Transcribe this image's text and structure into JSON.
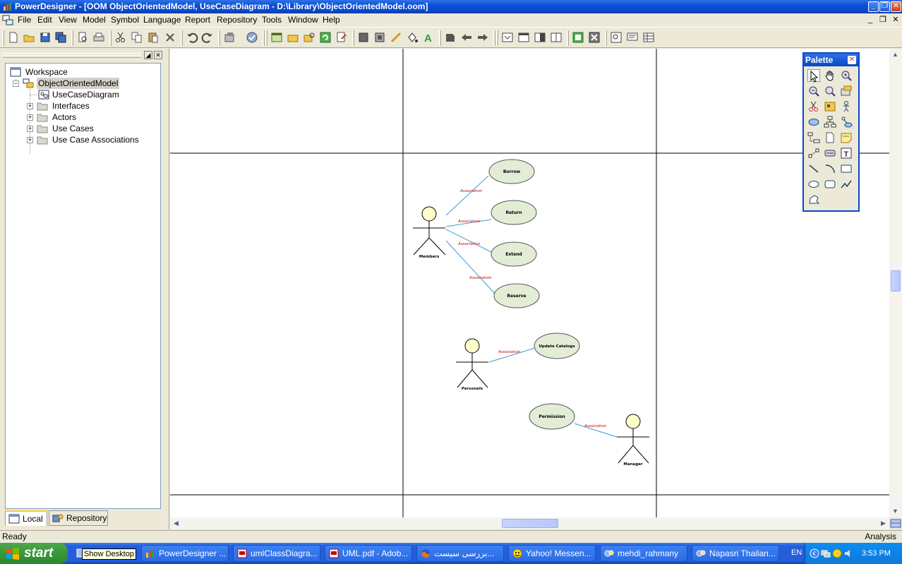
{
  "window": {
    "title": "PowerDesigner - [OOM ObjectOrientedModel, UseCaseDiagram - D:\\Library\\ObjectOrientedModel.oom]",
    "icon": "powerdesigner-icon"
  },
  "menu": {
    "items": [
      "File",
      "Edit",
      "View",
      "Model",
      "Symbol",
      "Language",
      "Report",
      "Repository",
      "Tools",
      "Window",
      "Help"
    ]
  },
  "tree": {
    "workspace": "Workspace",
    "model": "ObjectOrientedModel",
    "diagram": "UseCaseDiagram",
    "folders": [
      "Interfaces",
      "Actors",
      "Use Cases",
      "Use Case Associations"
    ]
  },
  "tabs": {
    "local": "Local",
    "repository": "Repository"
  },
  "palette": {
    "title": "Palette"
  },
  "diagram": {
    "actors": [
      "Members",
      "Personels",
      "Manager"
    ],
    "use_cases": [
      "Borrow",
      "Return",
      "Extend",
      "Reserve",
      "Update Catalogs",
      "Permission"
    ],
    "association_label": "Association"
  },
  "status": {
    "left": "Ready",
    "right": "Analysis"
  },
  "taskbar": {
    "start_label": "start",
    "tooltip": "Show Desktop",
    "tasks": [
      "PowerDesigner ...",
      "umlClassDiagra...",
      "UML.pdf - Adob...",
      "بررسی سیست...",
      "Yahoo! Messen...",
      "mehdi_rahmany",
      "Napasri Thailan..."
    ],
    "language": "EN",
    "clock": "3:53 PM"
  },
  "colors": {
    "titlebar": "#0a4fd6",
    "usecase_fill": "#e3ecd5",
    "actor_head": "#ffffcc",
    "association_line": "#3b9ad6",
    "association_text": "#cc0000"
  }
}
